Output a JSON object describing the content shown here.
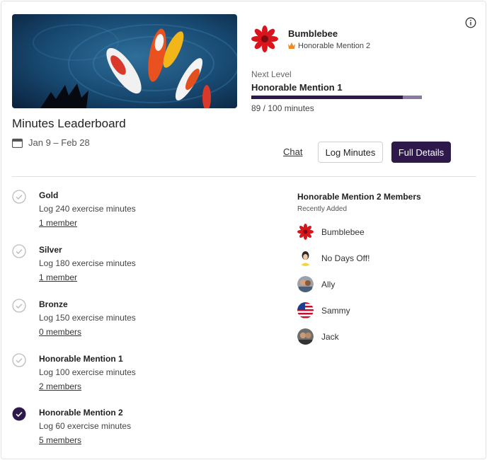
{
  "card": {
    "title": "Minutes Leaderboard",
    "date_range": "Jan 9 – Feb 28"
  },
  "profile": {
    "name": "Bumblebee",
    "rank": "Honorable Mention 2"
  },
  "next_level": {
    "label": "Next Level",
    "name": "Honorable Mention 1",
    "progress_text": "89 / 100 minutes",
    "progress_fraction": 0.89
  },
  "actions": {
    "chat": "Chat",
    "log_minutes": "Log Minutes",
    "full_details": "Full Details"
  },
  "levels": [
    {
      "name": "Gold",
      "desc": "Log 240 exercise minutes",
      "members": "1 member",
      "achieved": false
    },
    {
      "name": "Silver",
      "desc": "Log 180 exercise minutes",
      "members": "1 member",
      "achieved": false
    },
    {
      "name": "Bronze",
      "desc": "Log 150 exercise minutes",
      "members": "0 members",
      "achieved": false
    },
    {
      "name": "Honorable Mention 1",
      "desc": "Log 100 exercise minutes",
      "members": "2 members",
      "achieved": false
    },
    {
      "name": "Honorable Mention 2",
      "desc": "Log 60 exercise minutes",
      "members": "5 members",
      "achieved": true
    }
  ],
  "members_panel": {
    "title": "Honorable Mention 2 Members",
    "subtitle": "Recently Added",
    "members": [
      {
        "name": "Bumblebee",
        "avatar": "red-flower-avatar"
      },
      {
        "name": "No Days Off!",
        "avatar": "cartoon-person-avatar"
      },
      {
        "name": "Ally",
        "avatar": "photo-avatar"
      },
      {
        "name": "Sammy",
        "avatar": "us-flag-avatar"
      },
      {
        "name": "Jack",
        "avatar": "couple-photo-avatar"
      }
    ]
  },
  "colors": {
    "accent": "#2d1a4a",
    "progress_track": "#8a7aa3",
    "check_outline": "#bdbdbd"
  }
}
